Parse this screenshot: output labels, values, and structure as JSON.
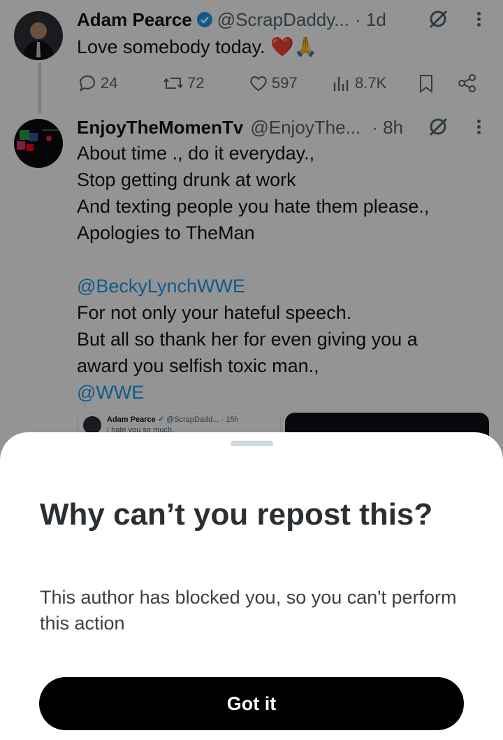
{
  "tweet1": {
    "name": "Adam Pearce",
    "handle": "@ScrapDaddy...",
    "time": "· 1d",
    "text": "Love somebody today. ❤️🙏",
    "replies": "24",
    "reposts": "72",
    "likes": "597",
    "views": "8.7K",
    "icons": [
      "verified-icon",
      "grok-icon",
      "more-icon",
      "reply-icon",
      "repost-icon",
      "like-icon",
      "views-icon",
      "bookmark-icon",
      "share-icon"
    ]
  },
  "tweet2": {
    "name": "EnjoyTheMomenTv",
    "handle": "@EnjoyThe...",
    "time": "· 8h",
    "lines": [
      "About time ., do it everyday.,",
      "Stop getting drunk at work",
      "And texting people you hate them please.,",
      "Apologies to TheMan",
      "",
      "@BeckyLynchWWE",
      "For not only your hateful speech.",
      "But all so thank her for even giving you a",
      "award you selfish toxic man.,",
      "@WWE"
    ],
    "quote": {
      "name": "Adam Pearce",
      "handle": "@ScrapDadd...",
      "time": "· 15h",
      "text": "I hate you so much."
    }
  },
  "sheet": {
    "title": "Why can’t you repost this?",
    "message": "This author has blocked you, so you can't perform this action",
    "button": "Got it"
  },
  "colors": {
    "accent": "#1d9bf0",
    "button": "#000000",
    "muted": "#536471",
    "heart": "#e0245e"
  }
}
